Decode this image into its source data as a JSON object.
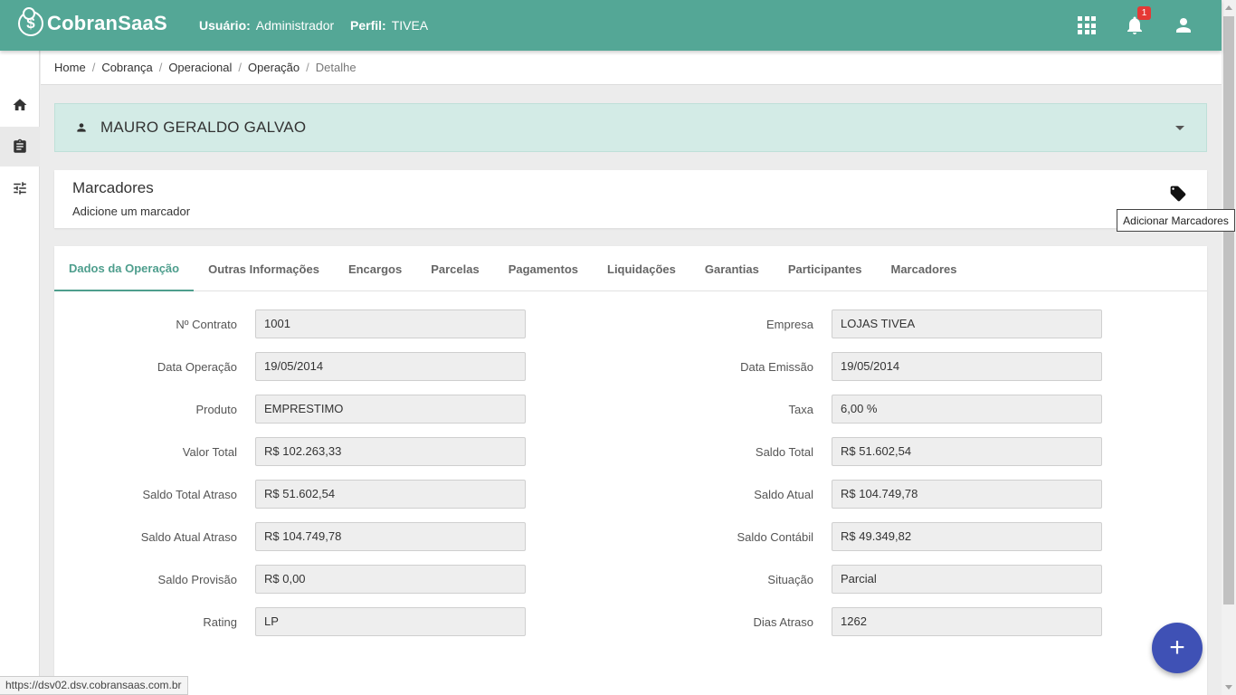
{
  "header": {
    "logo_text": "CobranSaaS",
    "user_label": "Usuário:",
    "user_value": "Administrador",
    "profile_label": "Perfil:",
    "profile_value": "TIVEA",
    "notification_count": "1",
    "icons": [
      "apps-icon",
      "bell-icon",
      "person-icon"
    ]
  },
  "sidebar": {
    "items": [
      {
        "icon": "home-icon"
      },
      {
        "icon": "clipboard-icon",
        "active": true
      },
      {
        "icon": "tune-icon"
      }
    ]
  },
  "breadcrumb": [
    "Home",
    "Cobrança",
    "Operacional",
    "Operação",
    "Detalhe"
  ],
  "client": {
    "name": "MAURO GERALDO GALVAO"
  },
  "markers": {
    "title": "Marcadores",
    "subtitle": "Adicione um marcador",
    "tooltip": "Adicionar Marcadores"
  },
  "tabs": [
    {
      "label": "Dados da Operação",
      "active": true
    },
    {
      "label": "Outras Informações"
    },
    {
      "label": "Encargos"
    },
    {
      "label": "Parcelas"
    },
    {
      "label": "Pagamentos"
    },
    {
      "label": "Liquidações"
    },
    {
      "label": "Garantias"
    },
    {
      "label": "Participantes"
    },
    {
      "label": "Marcadores"
    }
  ],
  "fields_left": [
    {
      "label": "Nº Contrato",
      "value": "1001"
    },
    {
      "label": "Data Operação",
      "value": "19/05/2014"
    },
    {
      "label": "Produto",
      "value": "EMPRESTIMO"
    },
    {
      "label": "Valor Total",
      "value": "R$ 102.263,33"
    },
    {
      "label": "Saldo Total Atraso",
      "value": "R$ 51.602,54"
    },
    {
      "label": "Saldo Atual Atraso",
      "value": "R$ 104.749,78"
    },
    {
      "label": "Saldo Provisão",
      "value": "R$ 0,00"
    },
    {
      "label": "Rating",
      "value": "LP"
    }
  ],
  "fields_right": [
    {
      "label": "Empresa",
      "value": "LOJAS TIVEA"
    },
    {
      "label": "Data Emissão",
      "value": "19/05/2014"
    },
    {
      "label": "Taxa",
      "value": "6,00 %"
    },
    {
      "label": "Saldo Total",
      "value": "R$ 51.602,54"
    },
    {
      "label": "Saldo Atual",
      "value": "R$ 104.749,78"
    },
    {
      "label": "Saldo Contábil",
      "value": "R$ 49.349,82"
    },
    {
      "label": "Situação",
      "value": "Parcial"
    },
    {
      "label": "Dias Atraso",
      "value": "1262"
    }
  ],
  "fab": {
    "label": "+"
  },
  "status_url": "https://dsv02.dsv.cobransaas.com.br",
  "colors": {
    "topbar": "#54a796",
    "accent": "#4e9e8d",
    "fab": "#3f51b5",
    "badge": "#e53935"
  }
}
